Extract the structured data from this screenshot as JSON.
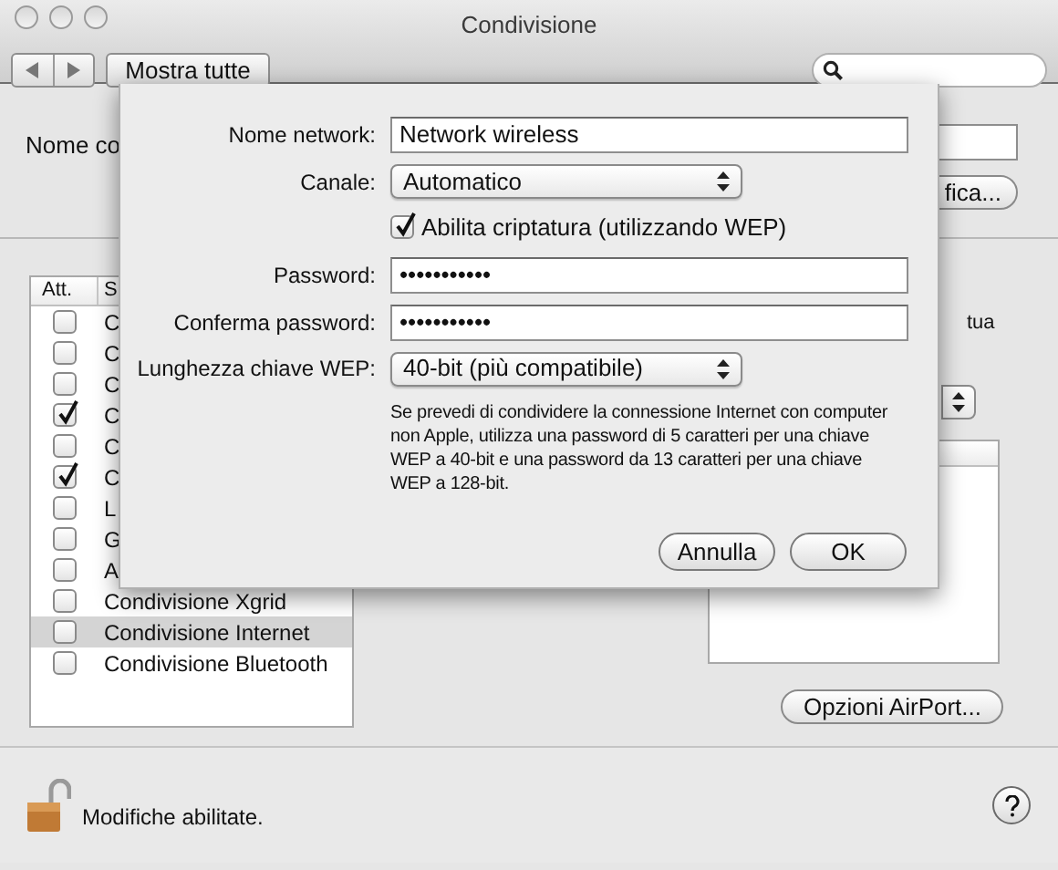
{
  "window": {
    "title": "Condivisione"
  },
  "toolbar": {
    "show_all": "Mostra tutte"
  },
  "computer_name": {
    "label": "Nome co",
    "edit_button": "fica..."
  },
  "services": {
    "columns": [
      "Att.",
      "S"
    ],
    "rows": [
      {
        "name": "C",
        "checked": false,
        "selected": false
      },
      {
        "name": "C",
        "checked": false,
        "selected": false
      },
      {
        "name": "C",
        "checked": false,
        "selected": false
      },
      {
        "name": "C",
        "checked": true,
        "selected": false
      },
      {
        "name": "C",
        "checked": false,
        "selected": false
      },
      {
        "name": "C",
        "checked": true,
        "selected": false
      },
      {
        "name": "L",
        "checked": false,
        "selected": false
      },
      {
        "name": "G",
        "checked": false,
        "selected": false
      },
      {
        "name": "A",
        "checked": false,
        "selected": false
      },
      {
        "name": "Condivisione Xgrid",
        "checked": false,
        "selected": false
      },
      {
        "name": "Condivisione Internet",
        "checked": false,
        "selected": true
      },
      {
        "name": "Condivisione Bluetooth",
        "checked": false,
        "selected": false
      }
    ]
  },
  "side_text": "tua",
  "airport_button": "Opzioni AirPort...",
  "status": "Modifiche abilitate.",
  "sheet": {
    "fields": [
      {
        "kind": "text",
        "label": "Nome network:",
        "value": "Network wireless"
      },
      {
        "kind": "select",
        "label": "Canale:",
        "value": "Automatico"
      },
      {
        "kind": "checkbox",
        "label": "Abilita criptatura (utilizzando WEP)",
        "checked": true
      },
      {
        "kind": "text",
        "label": "Password:",
        "value": "•••••••••••"
      },
      {
        "kind": "text",
        "label": "Conferma password:",
        "value": "•••••••••••"
      },
      {
        "kind": "select",
        "label": "Lunghezza chiave WEP:",
        "value": "40-bit (più compatibile)"
      }
    ],
    "note": "Se prevedi di condividere la connessione Internet con computer non Apple, utilizza una password di 5 caratteri per una chiave WEP a 40-bit e una password da 13 caratteri per una chiave WEP a 128-bit.",
    "buttons": [
      "Annulla",
      "OK"
    ]
  }
}
